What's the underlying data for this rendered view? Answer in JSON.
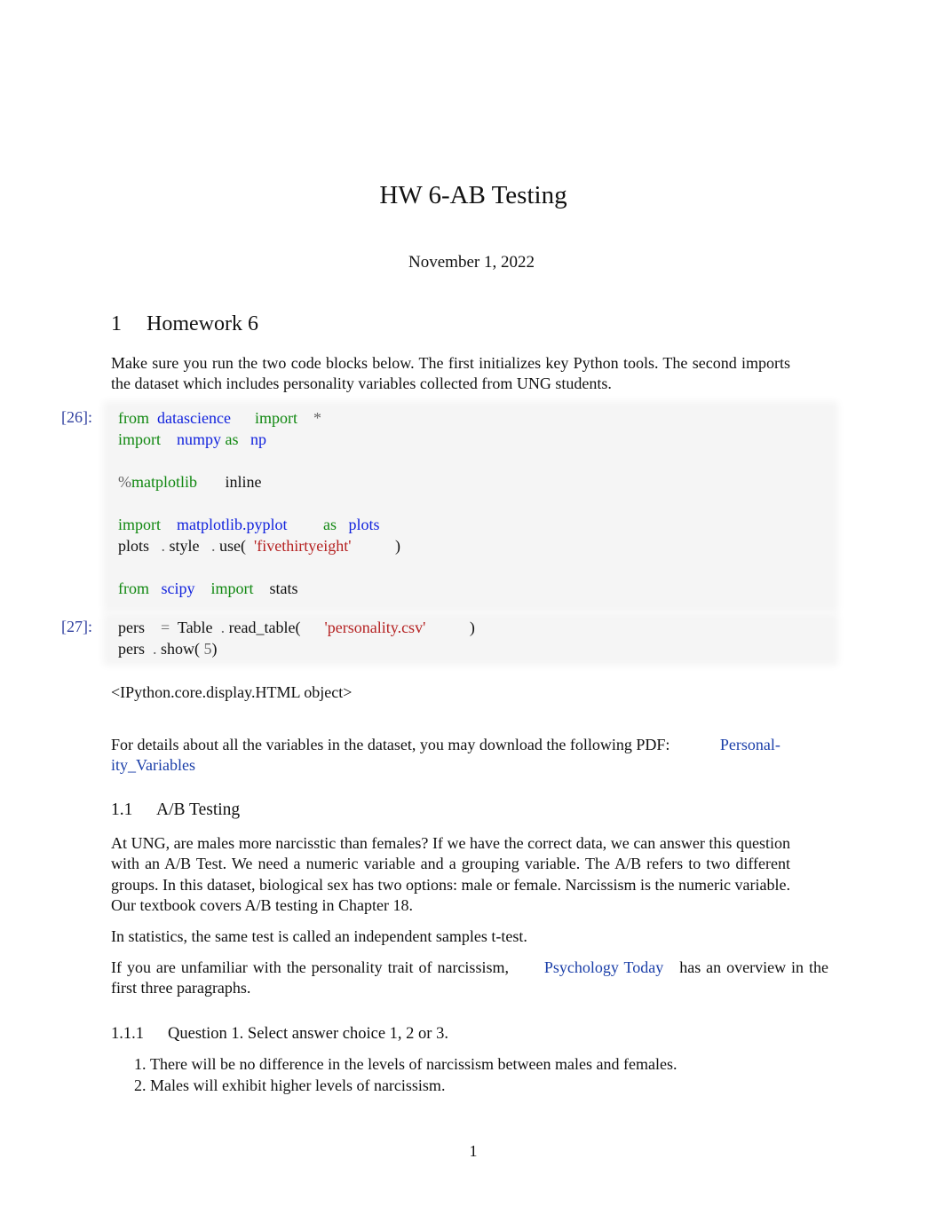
{
  "document": {
    "title": "HW 6-AB Testing",
    "date": "November 1, 2022",
    "page_number": "1"
  },
  "section1": {
    "number": "1",
    "title": "Homework 6",
    "intro": "Make sure you run the two code blocks below. The first initializes key Python tools. The second imports the dataset which includes personality variables collected from UNG students."
  },
  "cells": [
    {
      "prompt": "[26]:",
      "lines": [
        [
          {
            "t": "from",
            "c": "kw"
          },
          {
            "t": "  datascience",
            "c": "nm"
          },
          {
            "t": "      import",
            "c": "kw"
          },
          {
            "t": "    *",
            "c": "op"
          }
        ],
        [
          {
            "t": "import",
            "c": "kw"
          },
          {
            "t": "    numpy",
            "c": "nm"
          },
          {
            "t": " as",
            "c": "kw"
          },
          {
            "t": "   np",
            "c": "nm"
          }
        ],
        [],
        [
          {
            "t": "%",
            "c": "op"
          },
          {
            "t": "matplotlib",
            "c": "kw"
          },
          {
            "t": "       inline",
            "c": "tx"
          }
        ],
        [],
        [
          {
            "t": "import",
            "c": "kw"
          },
          {
            "t": "    matplotlib.pyplot",
            "c": "nm"
          },
          {
            "t": "         as",
            "c": "kw"
          },
          {
            "t": "   plots",
            "c": "nm"
          }
        ],
        [
          {
            "t": "plots",
            "c": "tx"
          },
          {
            "t": "   .",
            "c": "op"
          },
          {
            "t": " style",
            "c": "tx"
          },
          {
            "t": "   .",
            "c": "op"
          },
          {
            "t": " use(",
            "c": "tx"
          },
          {
            "t": "  'fivethirtyeight'",
            "c": "st"
          },
          {
            "t": "           )",
            "c": "tx"
          }
        ],
        [],
        [
          {
            "t": "from",
            "c": "kw"
          },
          {
            "t": "   scipy",
            "c": "nm"
          },
          {
            "t": "    import",
            "c": "kw"
          },
          {
            "t": "    stats",
            "c": "tx"
          }
        ]
      ]
    },
    {
      "prompt": "[27]:",
      "lines": [
        [
          {
            "t": "pers",
            "c": "tx"
          },
          {
            "t": "    =",
            "c": "op"
          },
          {
            "t": "  Table",
            "c": "tx"
          },
          {
            "t": "  .",
            "c": "op"
          },
          {
            "t": " read_table(",
            "c": "tx"
          },
          {
            "t": "      'personality.csv'",
            "c": "st"
          },
          {
            "t": "           )",
            "c": "tx"
          }
        ],
        [
          {
            "t": "pers",
            "c": "tx"
          },
          {
            "t": "  .",
            "c": "op"
          },
          {
            "t": " show(",
            "c": "tx"
          },
          {
            "t": " 5",
            "c": "op"
          },
          {
            "t": ")",
            "c": "tx"
          }
        ]
      ]
    }
  ],
  "output_text": "<IPython.core.display.HTML  object>",
  "details_paragraph": {
    "text": "For details about all the variables in the dataset, you may download the following PDF:",
    "link_label": "Personal-ity_Variables",
    "link_part1": "Personal-",
    "link_part2": "ity_Variables"
  },
  "section1_1": {
    "number": "1.1",
    "title": "A/B Testing",
    "paragraph1": "At UNG, are males more narcisstic than females? If we have the correct data, we can answer this question with an A/B Test. We need a numeric variable and a grouping variable. The A/B refers to two different groups. In this dataset, biological sex has two options: male or female. Narcissism is the numeric variable. Our textbook covers A/B testing in Chapter 18.",
    "paragraph2": "In statistics, the same test is called an independent samples t-test.",
    "paragraph3_before": "If you are unfamiliar with the personality trait of narcissism,",
    "paragraph3_link": "Psychology Today",
    "paragraph3_after": "has an overview in the first three paragraphs."
  },
  "section1_1_1": {
    "number": "1.1.1",
    "title": "Question 1. Select answer choice 1, 2 or 3.",
    "choices": [
      "There will be no difference in the levels of narcissism between males and females.",
      "Males will exhibit higher levels of narcissism."
    ]
  }
}
